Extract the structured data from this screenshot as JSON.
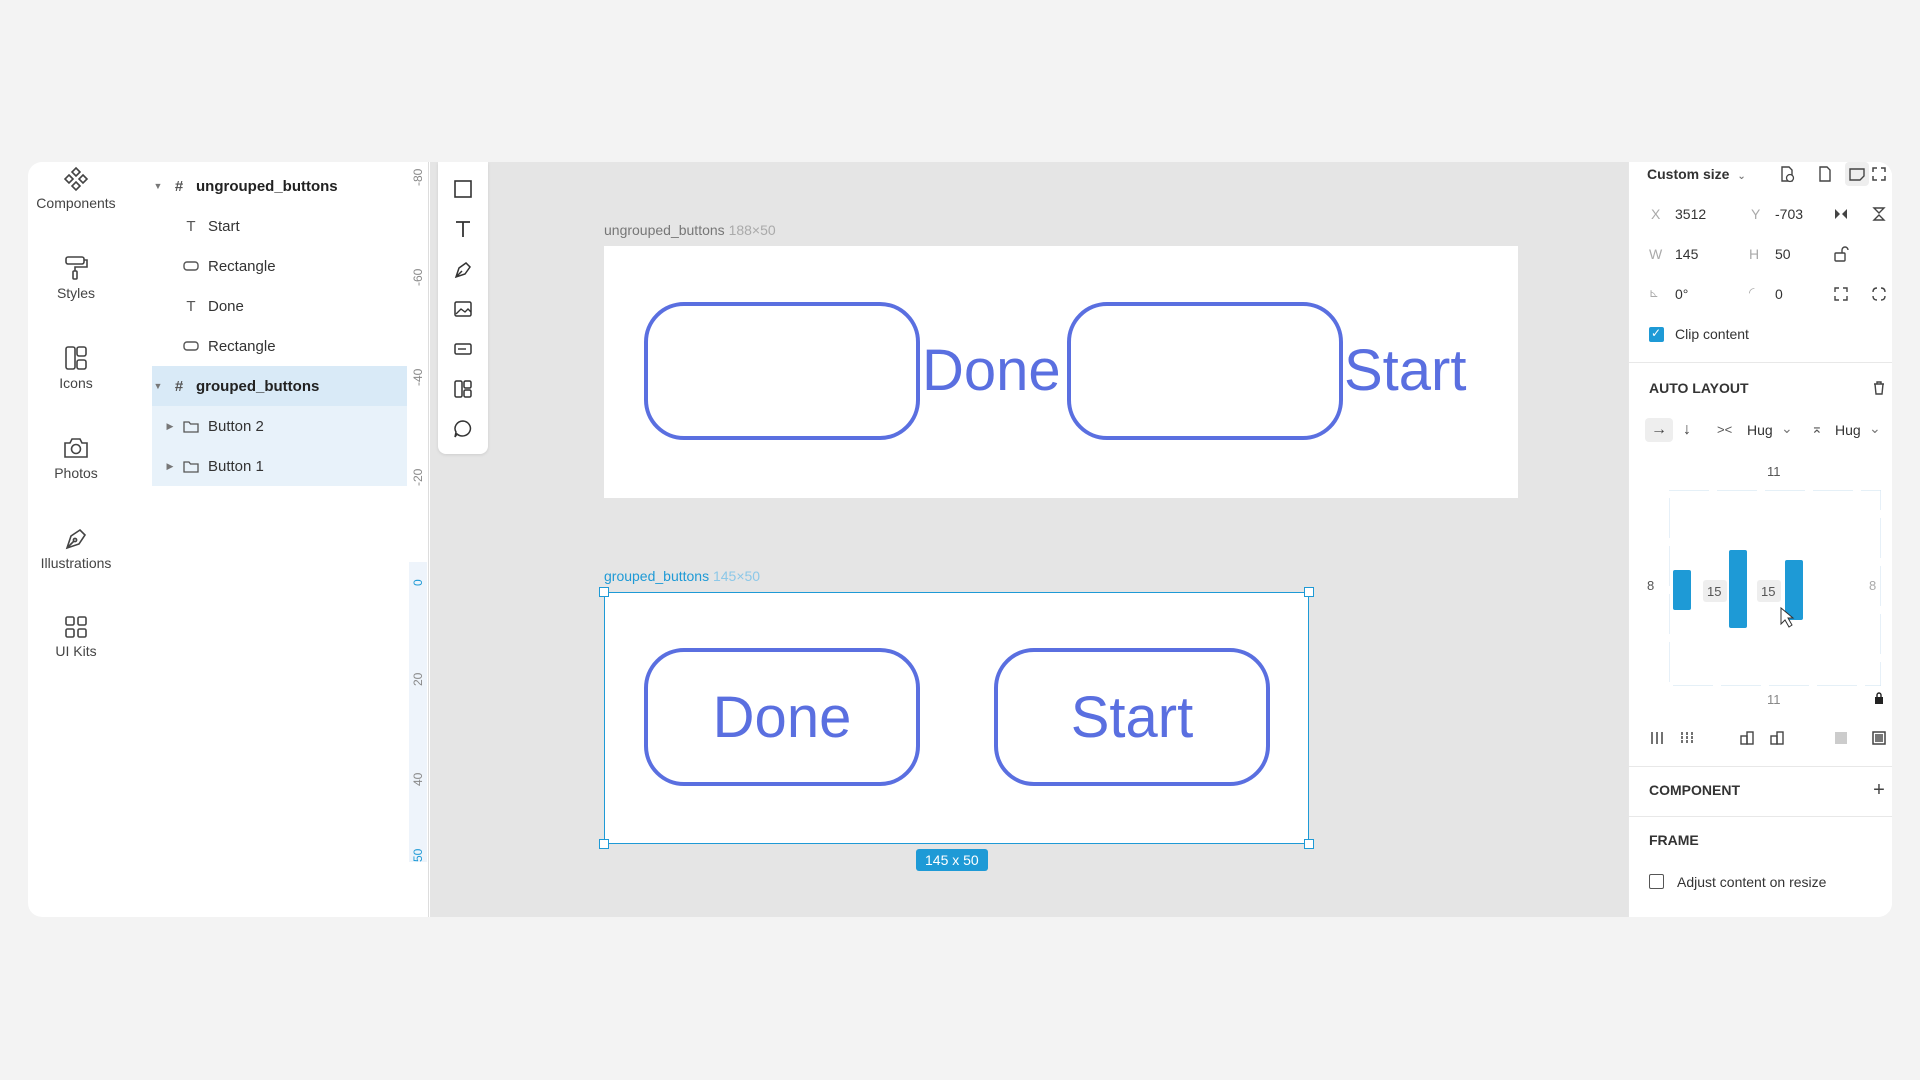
{
  "rail": [
    {
      "label": "Components",
      "icon": "components-icon"
    },
    {
      "label": "Styles",
      "icon": "paint-roller-icon"
    },
    {
      "label": "Icons",
      "icon": "icons-icon"
    },
    {
      "label": "Photos",
      "icon": "camera-icon"
    },
    {
      "label": "Illustrations",
      "icon": "pen-nib-icon"
    },
    {
      "label": "UI Kits",
      "icon": "grid-icon"
    }
  ],
  "layers": [
    {
      "name": "ungrouped_buttons",
      "type": "frame"
    },
    {
      "name": "Start",
      "type": "text"
    },
    {
      "name": "Rectangle",
      "type": "rect"
    },
    {
      "name": "Done",
      "type": "text"
    },
    {
      "name": "Rectangle",
      "type": "rect"
    },
    {
      "name": "grouped_buttons",
      "type": "frame"
    },
    {
      "name": "Button 2",
      "type": "group"
    },
    {
      "name": "Button 1",
      "type": "group"
    }
  ],
  "ruler": [
    "-80",
    "-60",
    "-40",
    "-20",
    "0",
    "20",
    "40",
    "50"
  ],
  "canvas": {
    "frame1": {
      "name": "ungrouped_buttons",
      "size": "188×50",
      "text1": "Done",
      "text2": "Start"
    },
    "frame2": {
      "name": "grouped_buttons",
      "size": "145×50",
      "btn1": "Done",
      "btn2": "Start",
      "badge": "145 x 50"
    }
  },
  "props": {
    "size_preset": "Custom size",
    "x_label": "X",
    "x": "3512",
    "y_label": "Y",
    "y": "-703",
    "w_label": "W",
    "w": "145",
    "h_label": "H",
    "h": "50",
    "rotation": "0°",
    "radius": "0",
    "clip_content": "Clip content",
    "auto_layout": "AUTO LAYOUT",
    "hug_w": "Hug",
    "hug_h": "Hug",
    "pad_top": "11",
    "pad_bottom": "11",
    "pad_left": "8",
    "pad_right": "8",
    "gap1": "15",
    "gap2": "15",
    "component": "COMPONENT",
    "frame": "FRAME",
    "adjust_content": "Adjust content on resize"
  },
  "colors": {
    "accent": "#1e9ad6",
    "button_stroke": "#5a6fe0",
    "selected_layer": "#d9eaf7"
  }
}
